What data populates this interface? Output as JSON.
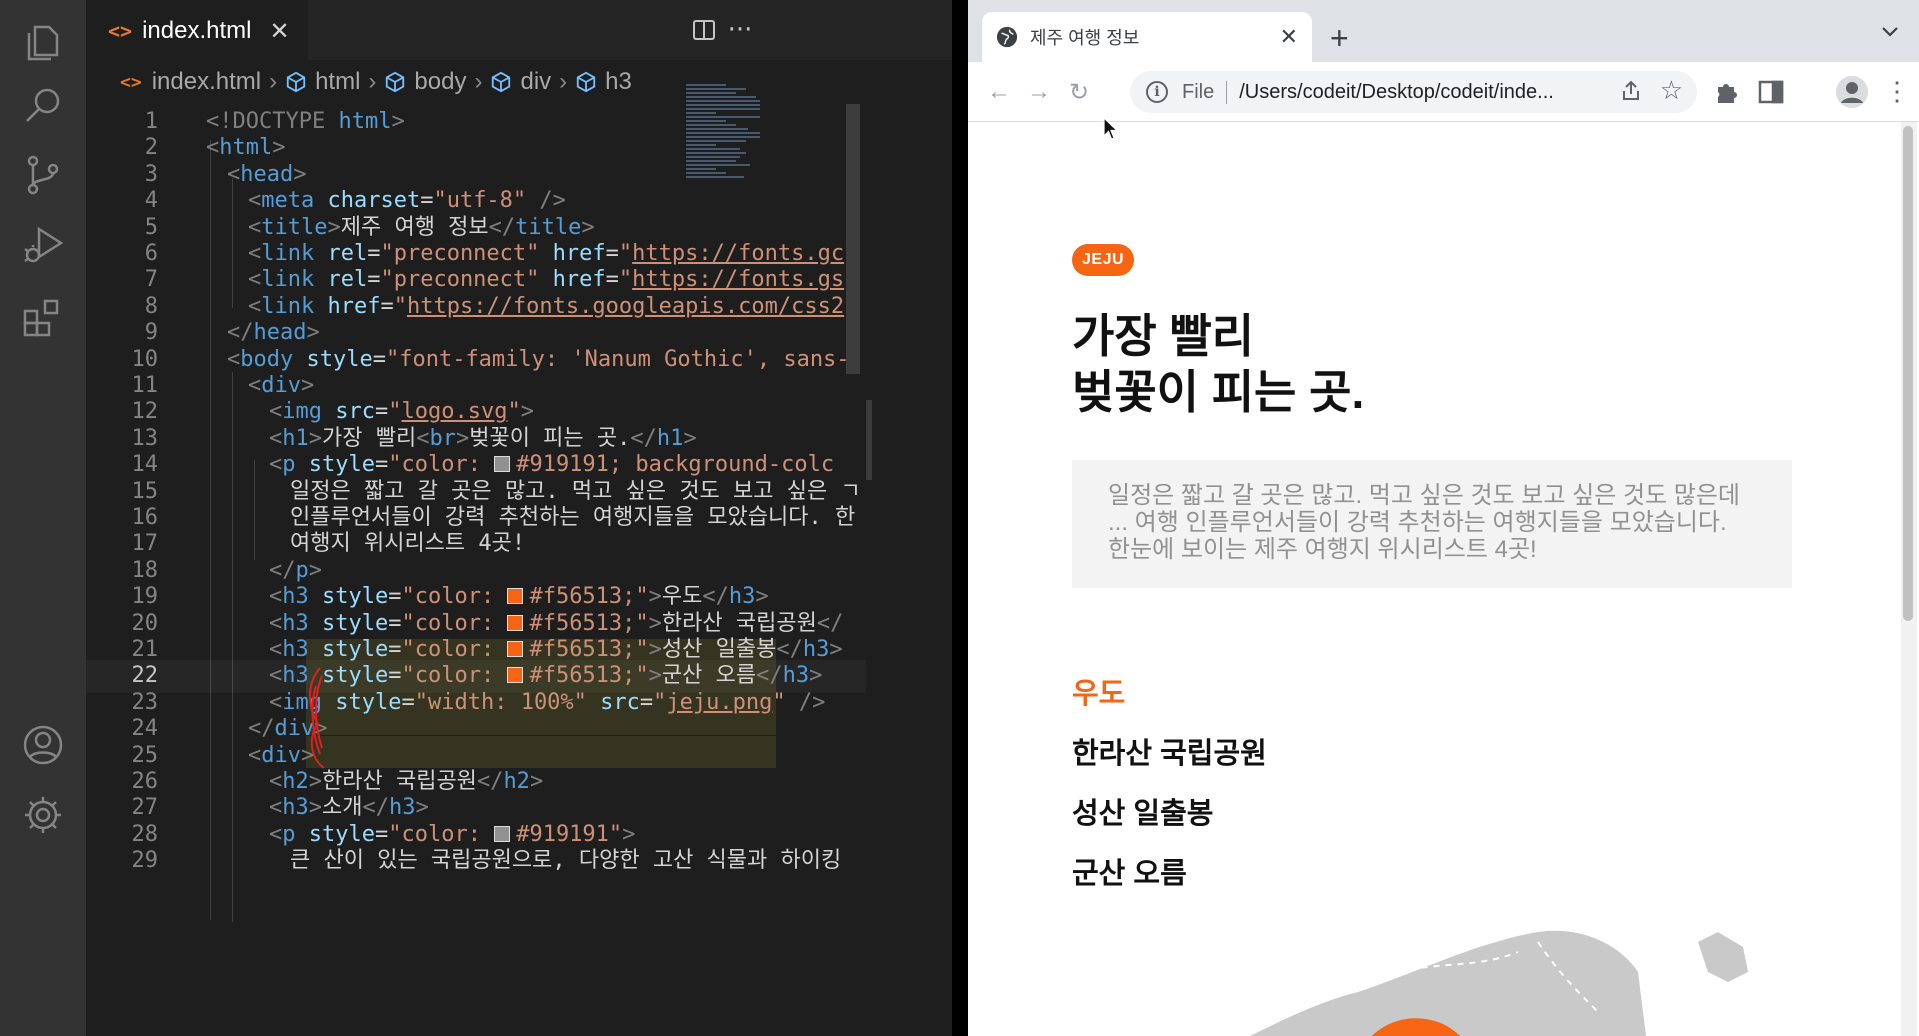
{
  "editor": {
    "tab": {
      "icon": "<>",
      "filename": "index.html",
      "close": "✕"
    },
    "actions": {
      "split": "⧉",
      "more": "···"
    },
    "breadcrumb": {
      "file": "index.html",
      "items": [
        "html",
        "body",
        "div",
        "h3"
      ]
    },
    "current_line": 22,
    "lines": [
      {
        "n": "1"
      },
      {
        "n": "2"
      },
      {
        "n": "3"
      },
      {
        "n": "4"
      },
      {
        "n": "5"
      },
      {
        "n": "6"
      },
      {
        "n": "7"
      },
      {
        "n": "8"
      },
      {
        "n": "9"
      },
      {
        "n": "10"
      },
      {
        "n": "11"
      },
      {
        "n": "12"
      },
      {
        "n": "13"
      },
      {
        "n": "14"
      },
      {
        "n": "15"
      },
      {
        "n": "16"
      },
      {
        "n": "17"
      },
      {
        "n": "18"
      },
      {
        "n": "19"
      },
      {
        "n": "20"
      },
      {
        "n": "21"
      },
      {
        "n": "22"
      },
      {
        "n": "23"
      },
      {
        "n": "24"
      },
      {
        "n": "25"
      },
      {
        "n": "26"
      },
      {
        "n": "27"
      },
      {
        "n": "28"
      },
      {
        "n": "29"
      }
    ],
    "code": {
      "l1": [
        "<!DOCTYPE ",
        "html",
        ">"
      ],
      "l2": [
        "<",
        "html",
        ">"
      ],
      "l3": [
        "<",
        "head",
        ">"
      ],
      "l4": [
        "<",
        "meta",
        " charset",
        "=",
        "\"utf-8\"",
        " />"
      ],
      "l5": [
        "<",
        "title",
        ">",
        "제주 여행 정보",
        "</",
        "title",
        ">"
      ],
      "l6": [
        "<",
        "link",
        " rel",
        "=",
        "\"preconnect\"",
        " href",
        "=",
        "\"",
        "https://fonts.gc"
      ],
      "l7": [
        "<",
        "link",
        " rel",
        "=",
        "\"preconnect\"",
        " href",
        "=",
        "\"",
        "https://fonts.gs"
      ],
      "l8": [
        "<",
        "link",
        " href",
        "=",
        "\"",
        "https://fonts.googleapis.com/css2"
      ],
      "l9": [
        "</",
        "head",
        ">"
      ],
      "l10": [
        "<",
        "body",
        " style",
        "=",
        "\"font-family: 'Nanum Gothic', sans-"
      ],
      "l11": [
        "<",
        "div",
        ">"
      ],
      "l12": [
        "<",
        "img",
        " src",
        "=",
        "\"",
        "logo.svg",
        "\"",
        ">"
      ],
      "l13": [
        "<",
        "h1",
        ">",
        "가장 빨리",
        "<",
        "br",
        ">",
        "벚꽃이 피는 곳.",
        "</",
        "h1",
        ">"
      ],
      "l14": [
        "<",
        "p",
        " style",
        "=",
        "\"color: ",
        "#919191; background-colc"
      ],
      "l15": "일정은 짧고 갈 곳은 많고. 먹고 싶은 것도 보고 싶은 ㄱ",
      "l16": "인플루언서들이 강력 추천하는 여행지들을 모았습니다. 한",
      "l17": "여행지 위시리스트 4곳!",
      "l18": [
        "</",
        "p",
        ">"
      ],
      "l19": [
        "<",
        "h3",
        " style",
        "=",
        "\"color: ",
        "#f56513;\"",
        ">",
        "우도",
        "</",
        "h3",
        ">"
      ],
      "l20": [
        "<",
        "h3",
        " style",
        "=",
        "\"color: ",
        "#f56513;\"",
        ">",
        "한라산 국립공원",
        "</"
      ],
      "l21": [
        "<",
        "h3",
        " style",
        "=",
        "\"color: ",
        "#f56513;\"",
        ">",
        "성산 일출봉",
        "</",
        "h3",
        ">"
      ],
      "l22": [
        "<",
        "h3",
        " style",
        "=",
        "\"color: ",
        "#f56513;\"",
        ">",
        "군산 오름",
        "</",
        "h3",
        ">"
      ],
      "l23": [
        "<",
        "img",
        " style",
        "=",
        "\"width: 100%\"",
        " src",
        "=",
        "\"",
        "jeju.png",
        "\"",
        " />"
      ],
      "l24": [
        "</",
        "div",
        ">"
      ],
      "l25": [
        "<",
        "div",
        ">"
      ],
      "l26": [
        "<",
        "h2",
        ">",
        "한라산 국립공원",
        "</",
        "h2",
        ">"
      ],
      "l27": [
        "<",
        "h3",
        ">",
        "소개",
        "</",
        "h3",
        ">"
      ],
      "l28": [
        "<",
        "p",
        " style",
        "=",
        "\"color: ",
        "#919191\"",
        ">"
      ],
      "l29": "큰 산이 있는 국립공원으로, 다양한 고산 식물과 하이킹"
    }
  },
  "browser": {
    "tab_title": "제주 여행 정보",
    "tab_close": "✕",
    "new_tab": "+",
    "nav": {
      "back": "←",
      "forward": "→",
      "reload": "↻"
    },
    "omnibox": {
      "info": "i",
      "scheme": "File",
      "url": "/Users/codeit/Desktop/codeit/inde..."
    },
    "star": "☆",
    "kebab": "⋮",
    "page": {
      "badge": "JEJU",
      "title_line1": "가장 빨리",
      "title_line2": "벚꽃이 피는 곳.",
      "intro_line1": "일정은 짧고 갈 곳은 많고. 먹고 싶은 것도 보고 싶은 것도 많은데",
      "intro_line2": "... 여행 인플루언서들이 강력 추천하는 여행지들을 모았습니다.",
      "intro_line3": "한눈에 보이는 제주 여행지 위시리스트 4곳!",
      "places": [
        "우도",
        "한라산 국립공원",
        "성산 일출봉",
        "군산 오름"
      ]
    }
  },
  "colors": {
    "accent": "#f56513",
    "gray_text": "#919191",
    "vscode_bg": "#1e1e1e",
    "swatch_gray": "#919191",
    "swatch_orange": "#f56513"
  },
  "icons": {
    "activity": [
      "explorer-icon",
      "search-icon",
      "source-control-icon",
      "run-debug-icon",
      "extensions-icon",
      "account-icon",
      "settings-gear-icon"
    ]
  }
}
